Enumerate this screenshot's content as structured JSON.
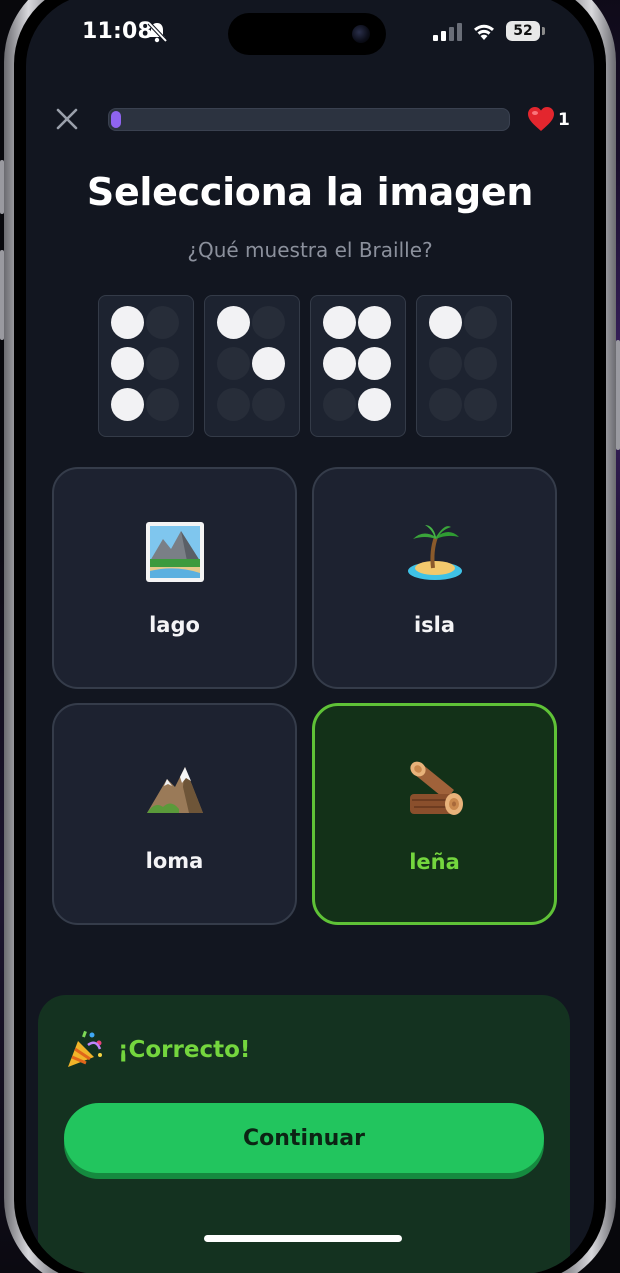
{
  "status_bar": {
    "time": "11:08",
    "battery": "52"
  },
  "top_bar": {
    "progress_fraction": 0.025,
    "lives": "1"
  },
  "title": "Selecciona la imagen",
  "subtitle": "¿Qué muestra el Braille?",
  "braille": [
    [
      1,
      0,
      1,
      0,
      1,
      0
    ],
    [
      1,
      0,
      0,
      1,
      0,
      0
    ],
    [
      1,
      1,
      1,
      1,
      0,
      1
    ],
    [
      1,
      0,
      0,
      0,
      0,
      0
    ]
  ],
  "options": [
    {
      "label": "lago",
      "icon": "landscape-photo-icon",
      "selected": false
    },
    {
      "label": "isla",
      "icon": "desert-island-icon",
      "selected": false
    },
    {
      "label": "loma",
      "icon": "mountain-icon",
      "selected": false
    },
    {
      "label": "leña",
      "icon": "wood-logs-icon",
      "selected": true
    }
  ],
  "feedback": {
    "text": "¡Correcto!",
    "button": "Continuar",
    "icon": "party-popper-icon"
  },
  "colors": {
    "accent_green": "#5fc237",
    "progress_purple": "#8f64f0",
    "button_green": "#22c55e"
  }
}
